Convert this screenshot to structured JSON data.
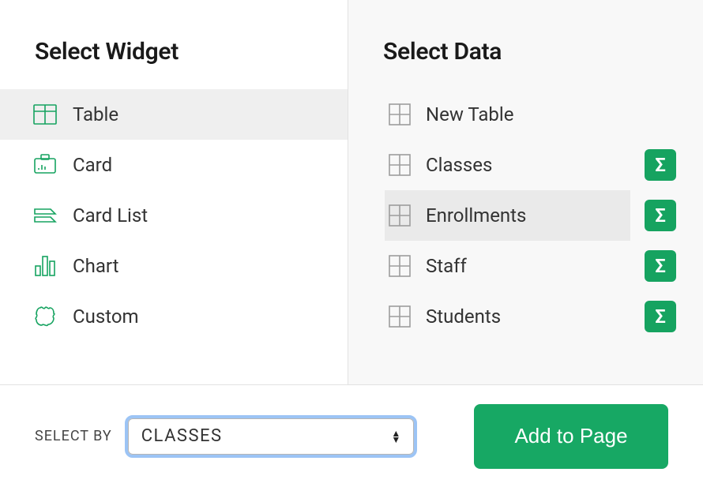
{
  "colors": {
    "accent": "#16a360"
  },
  "left": {
    "title": "Select Widget",
    "items": [
      {
        "label": "Table",
        "icon": "table-icon",
        "selected": true
      },
      {
        "label": "Card",
        "icon": "card-icon",
        "selected": false
      },
      {
        "label": "Card List",
        "icon": "card-list-icon",
        "selected": false
      },
      {
        "label": "Chart",
        "icon": "chart-icon",
        "selected": false
      },
      {
        "label": "Custom",
        "icon": "custom-icon",
        "selected": false
      }
    ]
  },
  "right": {
    "title": "Select Data",
    "items": [
      {
        "label": "New Table",
        "has_sigma": false,
        "selected": false
      },
      {
        "label": "Classes",
        "has_sigma": true,
        "selected": false
      },
      {
        "label": "Enrollments",
        "has_sigma": true,
        "selected": true
      },
      {
        "label": "Staff",
        "has_sigma": true,
        "selected": false
      },
      {
        "label": "Students",
        "has_sigma": true,
        "selected": false
      }
    ]
  },
  "footer": {
    "select_by_label": "SELECT BY",
    "select_by_value": "CLASSES",
    "button_label": "Add to Page"
  }
}
